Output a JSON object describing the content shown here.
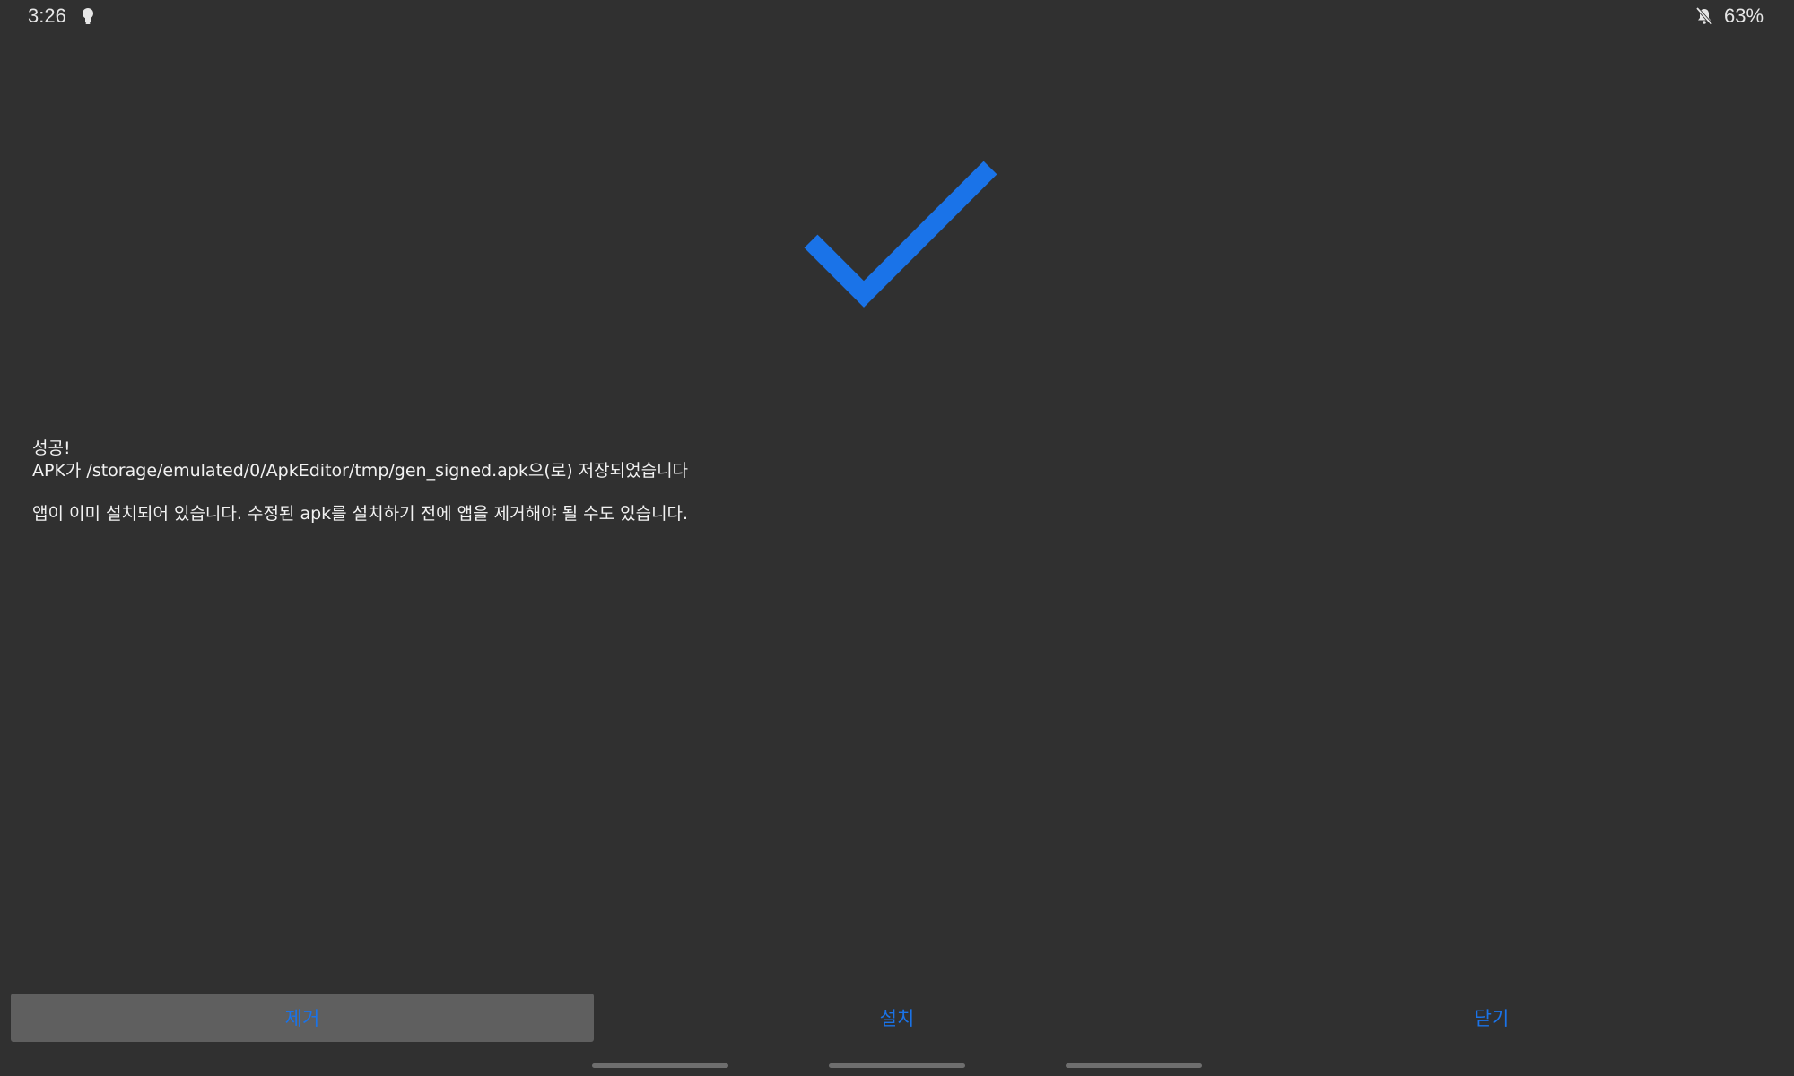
{
  "status_bar": {
    "time": "3:26",
    "battery": "63%",
    "icons": [
      "lightbulb-icon",
      "mute-icon"
    ]
  },
  "success_icon": "checkmark-icon",
  "colors": {
    "background": "#303030",
    "accent": "#1a73e8",
    "text": "#f2f2f2"
  },
  "message": {
    "title": "성공!",
    "saved_path": "APK가 /storage/emulated/0/ApkEditor/tmp/gen_signed.apk으(로) 저장되었습니다",
    "note": "앱이 이미 설치되어 있습니다. 수정된 apk를 설치하기 전에 앱을 제거해야 될 수도 있습니다."
  },
  "actions": {
    "remove_label": "제거",
    "install_label": "설치",
    "close_label": "닫기"
  }
}
